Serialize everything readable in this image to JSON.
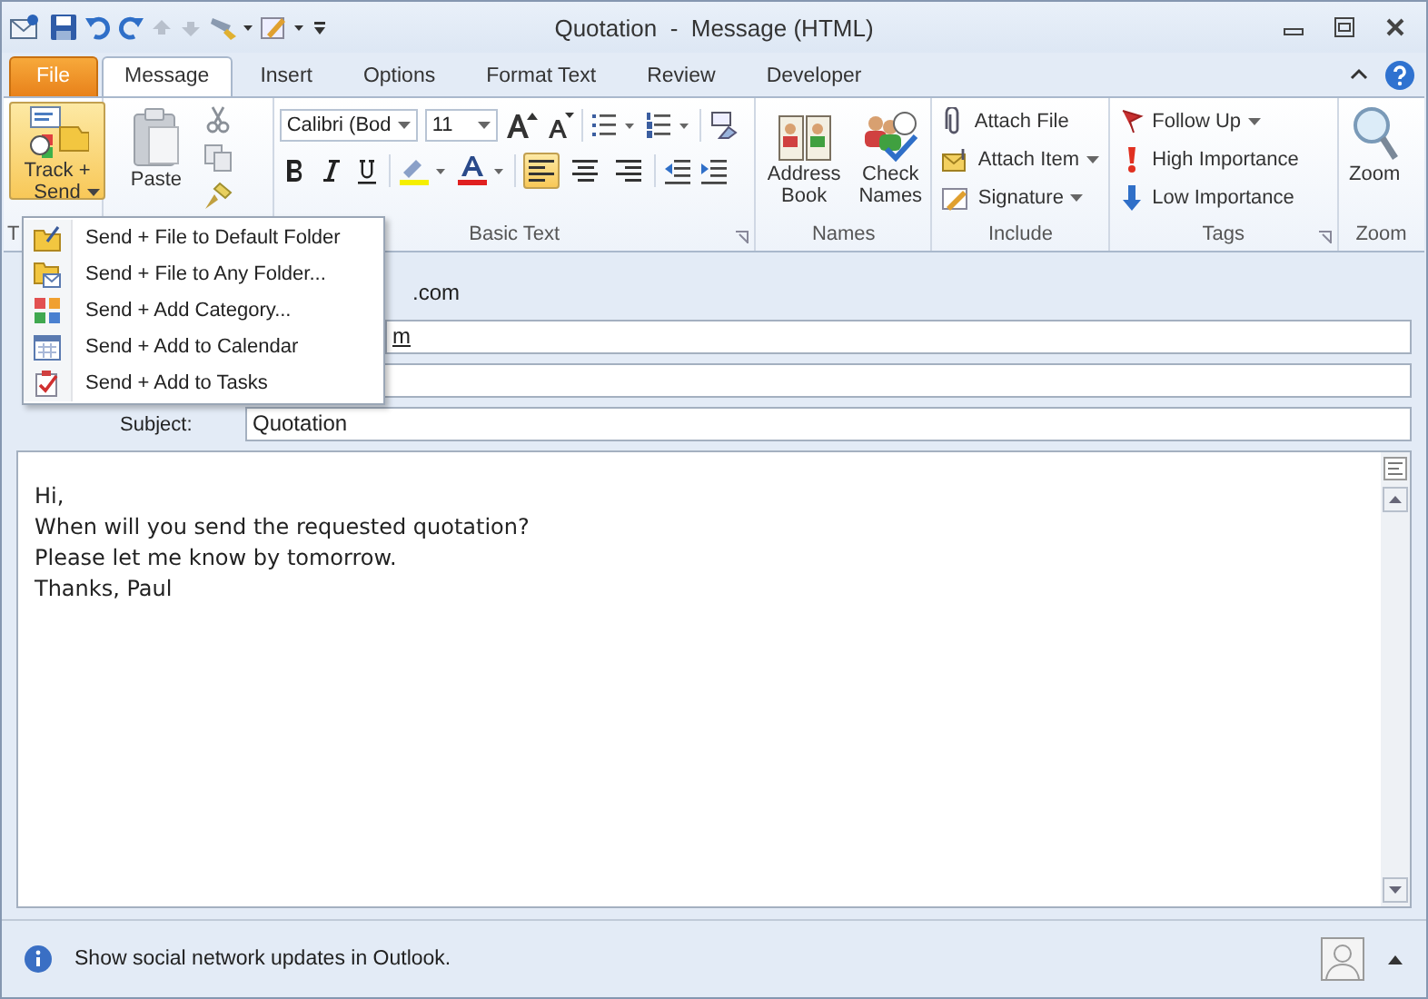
{
  "window": {
    "title": "Quotation  -  Message (HTML)"
  },
  "tabs": [
    {
      "label": "File",
      "kind": "file",
      "selected": false
    },
    {
      "label": "Message",
      "kind": "tab",
      "selected": true
    },
    {
      "label": "Insert",
      "kind": "tab",
      "selected": false
    },
    {
      "label": "Options",
      "kind": "tab",
      "selected": false
    },
    {
      "label": "Format Text",
      "kind": "tab",
      "selected": false
    },
    {
      "label": "Review",
      "kind": "tab",
      "selected": false
    },
    {
      "label": "Developer",
      "kind": "tab",
      "selected": false
    }
  ],
  "tracking": {
    "button": {
      "lines": [
        "Track +",
        "Send"
      ],
      "pressed": true
    },
    "group_label": "T"
  },
  "clipboard": {
    "paste": "Paste"
  },
  "basic_text": {
    "font": "Calibri (Bod",
    "size": "11",
    "label": "Basic Text",
    "alignment": [
      {
        "kind": "left",
        "selected": true
      },
      {
        "kind": "center",
        "selected": false
      },
      {
        "kind": "right",
        "selected": false
      }
    ]
  },
  "names": {
    "buttons": [
      {
        "lines": [
          "Address",
          "Book"
        ]
      },
      {
        "lines": [
          "Check",
          "Names"
        ]
      }
    ],
    "label": "Names"
  },
  "include": {
    "items": [
      {
        "label": "Attach File",
        "dropdown": false
      },
      {
        "label": "Attach Item",
        "dropdown": true
      },
      {
        "label": "Signature",
        "dropdown": true
      }
    ],
    "label": "Include"
  },
  "tags": {
    "items": [
      {
        "label": "Follow Up",
        "dropdown": true
      },
      {
        "label": "High Importance",
        "dropdown": false
      },
      {
        "label": "Low Importance",
        "dropdown": false
      }
    ],
    "label": "Tags"
  },
  "zoom": {
    "button": "Zoom",
    "label": "Zoom"
  },
  "track_menu": {
    "items": [
      {
        "label": "Send + File to Default Folder"
      },
      {
        "label": "Send + File to Any Folder..."
      },
      {
        "label": "Send + Add Category..."
      },
      {
        "label": "Send + Add to Calendar"
      },
      {
        "label": "Send + Add to Tasks"
      }
    ]
  },
  "header": {
    "from_partial": ".com",
    "to_partial": "m",
    "subject_label": "Subject:",
    "subject": "Quotation"
  },
  "body": {
    "lines": [
      "Hi,",
      "When will you send the requested quotation?",
      "Please let me know by tomorrow.",
      "Thanks, Paul"
    ]
  },
  "status_bar": {
    "message": "Show social network updates in Outlook."
  }
}
